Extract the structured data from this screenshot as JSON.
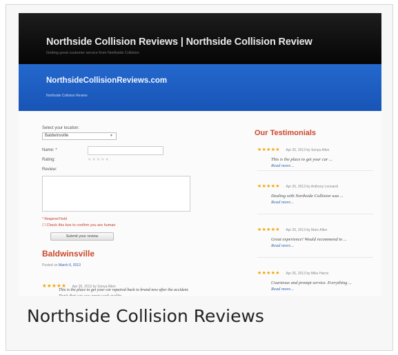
{
  "caption": "Northside Collision Reviews",
  "site": {
    "title": "Northside Collision Reviews | Northside Collision Review",
    "tagline": "Getting great customer service from Northside Collision",
    "band_title": "NorthsideCollisionReviews.com",
    "band_subtitle": "Northside Collision Review"
  },
  "form": {
    "location_label": "Select your location:",
    "location_value": "Baldwinsville",
    "name_label": "Name: *",
    "rating_label": "Rating:",
    "rating_stars": "★★★★★",
    "review_label": "Review:",
    "required_text": "* Required Field",
    "check_text": "Check this box to confirm you are human",
    "submit_label": "Submit your review"
  },
  "location": {
    "heading": "Baldwinsville",
    "posted_prefix": "Posted on",
    "posted_date": "March 6, 2013"
  },
  "review": {
    "stars": "★★★★★",
    "meta": "Apr 26, 2013 by Sonya Allen",
    "text": "This is the place to get your car repaired back to brand new after the accident. Don’s that was you great work quality ..."
  },
  "testimonials": {
    "heading": "Our Testimonials",
    "items": [
      {
        "stars": "★★★★★",
        "meta": "Apr 26, 2013 by Sonya Allen",
        "quote": "This is the place to get your car ...",
        "more": "Read more..."
      },
      {
        "stars": "★★★★★",
        "meta": "Apr 26, 2013 by Anthony Leonardi",
        "quote": "Dealing with Northside Collision was ...",
        "more": "Read more..."
      },
      {
        "stars": "★★★★★",
        "meta": "Apr 26, 2013 by Marc Allen",
        "quote": "Great experience! Would recommend to ...",
        "more": "Read more..."
      },
      {
        "stars": "★★★★★",
        "meta": "Apr 26, 2013 by Mike Harris",
        "quote": "Courteous and prompt service. Everything ...",
        "more": "Read more..."
      }
    ]
  },
  "colors": {
    "header_bg": "#0a0a0a",
    "band_bg": "#1e5ec4",
    "accent_heading": "#c9472b",
    "star_gold": "#f0a400",
    "link_blue": "#2a5db0"
  }
}
